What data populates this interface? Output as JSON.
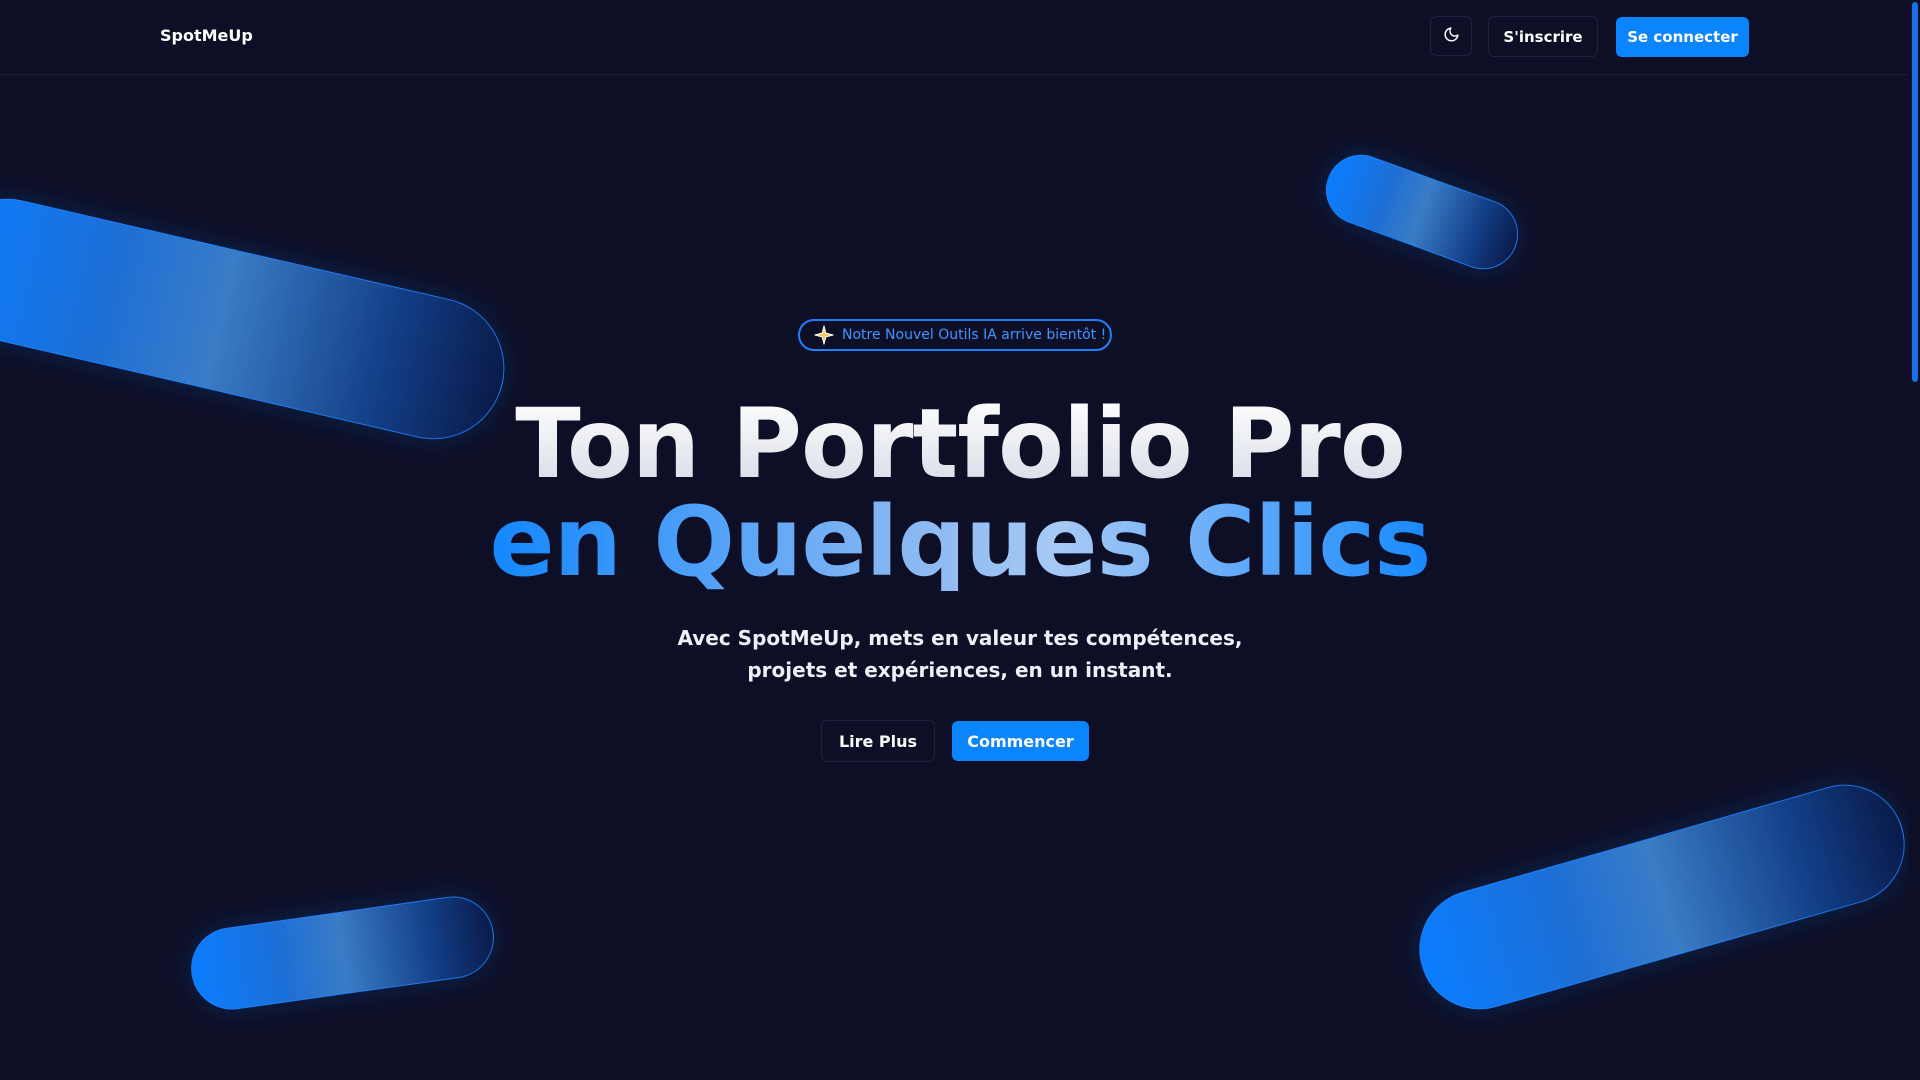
{
  "header": {
    "brand": "SpotMeUp",
    "theme_toggle_icon": "moon-icon",
    "signup_label": "S'inscrire",
    "login_label": "Se connecter"
  },
  "hero": {
    "badge": {
      "icon": "sparkle-icon",
      "text": "Notre Nouvel Outils IA arrive bientôt !"
    },
    "title_line1": "Ton Portfolio Pro",
    "title_line2": "en Quelques Clics",
    "subtitle_line1": "Avec SpotMeUp, mets en valeur tes compétences,",
    "subtitle_line2": "projets et expériences, en un instant.",
    "secondary_cta": "Lire Plus",
    "primary_cta": "Commencer"
  },
  "colors": {
    "background": "#0d0f26",
    "accent": "#0a84ff",
    "badge_text": "#3f95ff"
  }
}
